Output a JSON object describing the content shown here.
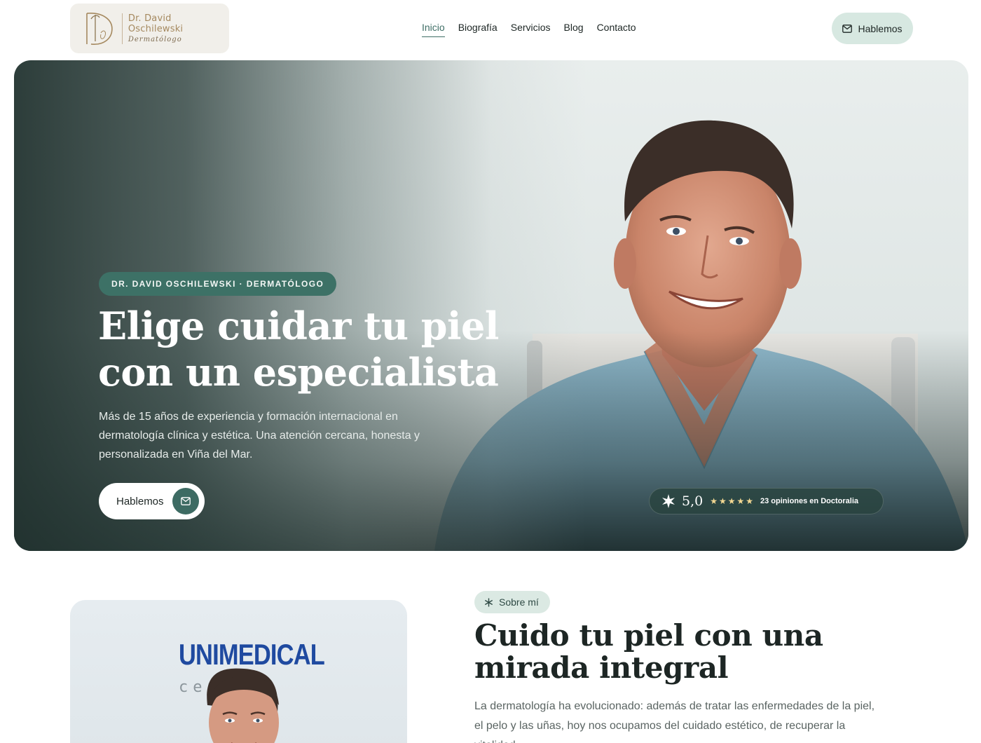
{
  "header": {
    "logo": {
      "name": "Dr. David Oschilewski",
      "subtitle": "Dermatólogo"
    },
    "nav": [
      {
        "label": "Inicio",
        "active": true
      },
      {
        "label": "Biografía",
        "active": false
      },
      {
        "label": "Servicios",
        "active": false
      },
      {
        "label": "Blog",
        "active": false
      },
      {
        "label": "Contacto",
        "active": false
      }
    ],
    "cta": {
      "label": "Hablemos",
      "icon": "mail-icon"
    }
  },
  "hero": {
    "badge": "DR. DAVID OSCHILEWSKI · DERMATÓLOGO",
    "title": "Elige cuidar tu piel con un especialista",
    "subtitle": "Más de 15 años de experiencia y formación internacional en dermatología clínica y estética. Una atención cercana, honesta y personalizada en Viña del Mar.",
    "cta": {
      "label": "Hablemos",
      "icon": "mail-icon"
    },
    "rating": {
      "icon": "doctoralia-icon",
      "score": "5,0",
      "stars": "★★★★★",
      "text": "23 opiniones en Doctoralia"
    }
  },
  "about": {
    "photo_sign": {
      "brand": "UNIMEDICAL",
      "subtitle": "cent      co"
    },
    "tag": {
      "label": "Sobre mí",
      "icon": "asterisk-icon"
    },
    "title": "Cuido tu piel con una mirada integral",
    "text": "La dermatología ha evolucionado: además de tratar las enfermedades de la piel, el pelo y las uñas, hoy nos ocupamos del cuidado estético, de recuperar la vitalidad"
  },
  "colors": {
    "accent": "#3d7166",
    "accent_light": "#d7e8e1",
    "logo_gold": "#a5895f",
    "star": "#f3d892",
    "text_dark": "#1d2624"
  }
}
